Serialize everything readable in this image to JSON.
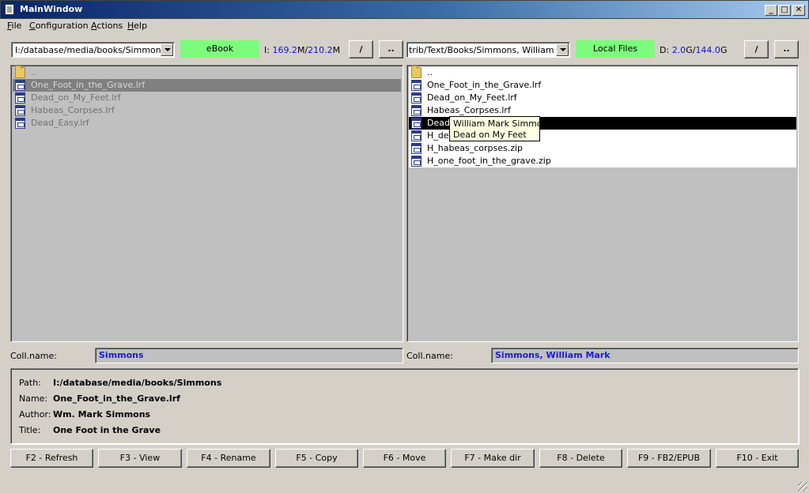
{
  "window": {
    "title": "MainWindow",
    "controls": [
      "_",
      "□",
      "✕"
    ]
  },
  "menu": [
    "File",
    "Configuration",
    "Actions",
    "Help"
  ],
  "left": {
    "path": "I:/database/media/books/Simmons",
    "source": "eBook",
    "space": {
      "drive": "I:",
      "free": "169.2",
      "free_unit": "M",
      "sep": "/",
      "total": "210.2",
      "total_unit": "M"
    },
    "root_button": "/",
    "up_button": "..",
    "files": [
      "..",
      "One_Foot_in_the_Grave.lrf",
      "Dead_on_My_Feet.lrf",
      "Habeas_Corpses.lrf",
      "Dead_Easy.lrf"
    ],
    "coll_label": "Coll.name:",
    "coll_value": "Simmons"
  },
  "right": {
    "path": "trib/Text/Books/Simmons, William Mark",
    "source": "Local Files",
    "space": {
      "drive": "D:",
      "free": "2.0",
      "free_unit": "G",
      "sep": "/",
      "total": "144.0",
      "total_unit": "G"
    },
    "root_button": "/",
    "up_button": "..",
    "files": [
      "..",
      "One_Foot_in_the_Grave.lrf",
      "Dead_on_My_Feet.lrf",
      "Habeas_Corpses.lrf",
      "Dead",
      "H_dea",
      "H_habeas_corpses.zip",
      "H_one_foot_in_the_grave.zip"
    ],
    "coll_label": "Coll.name:",
    "coll_value": "Simmons, William Mark"
  },
  "tooltip": {
    "line1": "William Mark Simmons",
    "line2": "Dead on My Feet"
  },
  "info": {
    "path_label": "Path:",
    "path": "I:/database/media/books/Simmons",
    "name_label": "Name:",
    "name": "One_Foot_in_the_Grave.lrf",
    "author_label": "Author:",
    "author": "Wm. Mark Simmons",
    "title_label": "Title:",
    "title": "One Foot in the Grave"
  },
  "fkeys": [
    "F2 - Refresh",
    "F3 - View",
    "F4 - Rename",
    "F5 - Copy",
    "F6 - Move",
    "F7 - Make dir",
    "F8 - Delete",
    "F9 - FB2/EPUB",
    "F10 - Exit"
  ]
}
